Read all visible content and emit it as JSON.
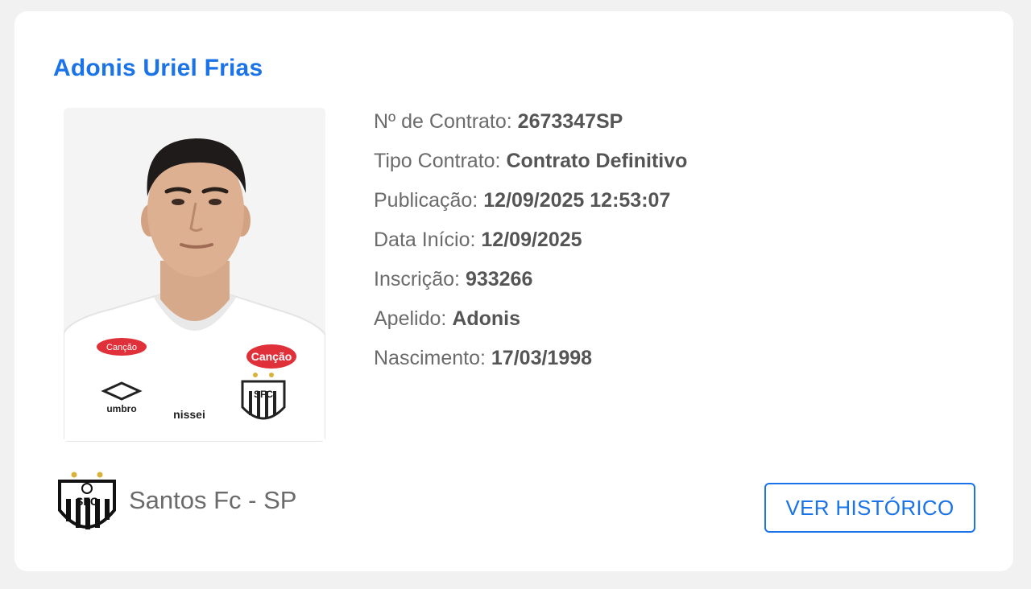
{
  "player": {
    "name": "Adonis Uriel Frias",
    "photo_alt": "player-photo"
  },
  "details": [
    {
      "label": "Nº de Contrato:",
      "value": "2673347SP"
    },
    {
      "label": "Tipo Contrato:",
      "value": "Contrato Definitivo"
    },
    {
      "label": "Publicação:",
      "value": "12/09/2025 12:53:07"
    },
    {
      "label": "Data Início:",
      "value": "12/09/2025"
    },
    {
      "label": "Inscrição:",
      "value": "933266"
    },
    {
      "label": "Apelido:",
      "value": "Adonis"
    },
    {
      "label": "Nascimento:",
      "value": "17/03/1998"
    }
  ],
  "club": {
    "name": "Santos Fc - SP",
    "crest_icon": "club-crest-icon",
    "crest_text": "SFC"
  },
  "jersey": {
    "sponsor_main": "Canção",
    "brand": "umbro",
    "sponsor_lower": "nissei"
  },
  "actions": {
    "history_label": "VER HISTÓRICO"
  },
  "colors": {
    "accent": "#1a73e8",
    "text_muted": "#6b6b6b",
    "sponsor_red": "#e0313a"
  }
}
